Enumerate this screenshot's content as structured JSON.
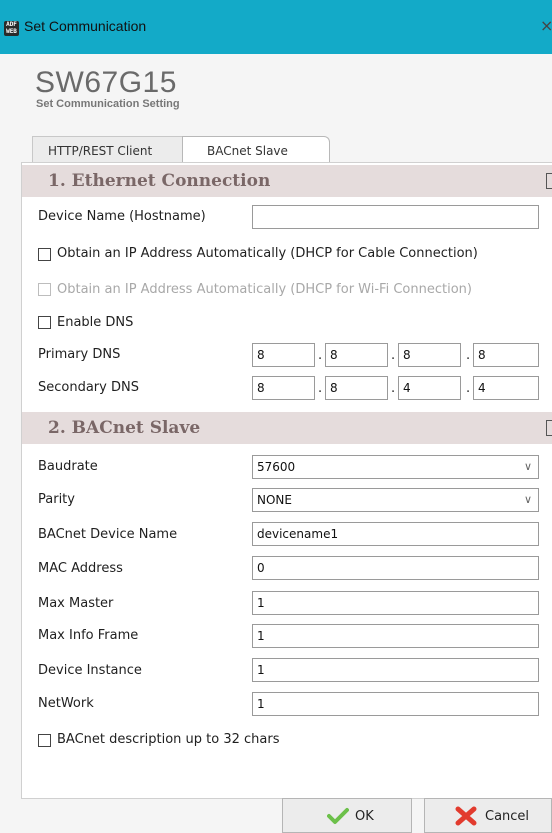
{
  "window": {
    "title": "Set Communication",
    "app_icon_text": "ADF WEB",
    "close_glyph": "×"
  },
  "header": {
    "title": "SW67G15",
    "subtitle": "Set Communication Setting"
  },
  "tabs": [
    {
      "label": "HTTP/REST Client",
      "active": false
    },
    {
      "label": "BACnet Slave",
      "active": true
    }
  ],
  "ethernet": {
    "section_title": "1. Ethernet Connection",
    "device_name_label": "Device Name (Hostname)",
    "device_name_value": "",
    "dhcp_cable_label": "Obtain an IP Address Automatically (DHCP for Cable Connection)",
    "dhcp_cable_checked": false,
    "dhcp_wifi_label": "Obtain an IP Address Automatically (DHCP for Wi-Fi Connection)",
    "dhcp_wifi_checked": false,
    "enable_dns_label": "Enable DNS",
    "enable_dns_checked": false,
    "primary_dns_label": "Primary DNS",
    "primary_dns": [
      "8",
      "8",
      "8",
      "8"
    ],
    "secondary_dns_label": "Secondary DNS",
    "secondary_dns": [
      "8",
      "8",
      "4",
      "4"
    ],
    "octet_separator": "."
  },
  "bacnet": {
    "section_title": "2. BACnet Slave",
    "baudrate_label": "Baudrate",
    "baudrate_value": "57600",
    "parity_label": "Parity",
    "parity_value": "NONE",
    "device_name_label": "BACnet Device Name",
    "device_name_value": "devicename1",
    "mac_label": "MAC Address",
    "mac_value": "0",
    "max_master_label": "Max Master",
    "max_master_value": "1",
    "max_info_label": "Max Info Frame",
    "max_info_value": "1",
    "device_instance_label": "Device Instance",
    "device_instance_value": "1",
    "network_label": "NetWork",
    "network_value": "1",
    "description_label": "BACnet description up to 32 chars",
    "description_checked": false,
    "chevron_glyph": "∨"
  },
  "footer": {
    "ok_label": "OK",
    "cancel_label": "Cancel",
    "ok_icon": "checkmark-icon",
    "cancel_icon": "x-icon",
    "ok_color": "#6cc04a",
    "cancel_color": "#e23b2e"
  }
}
